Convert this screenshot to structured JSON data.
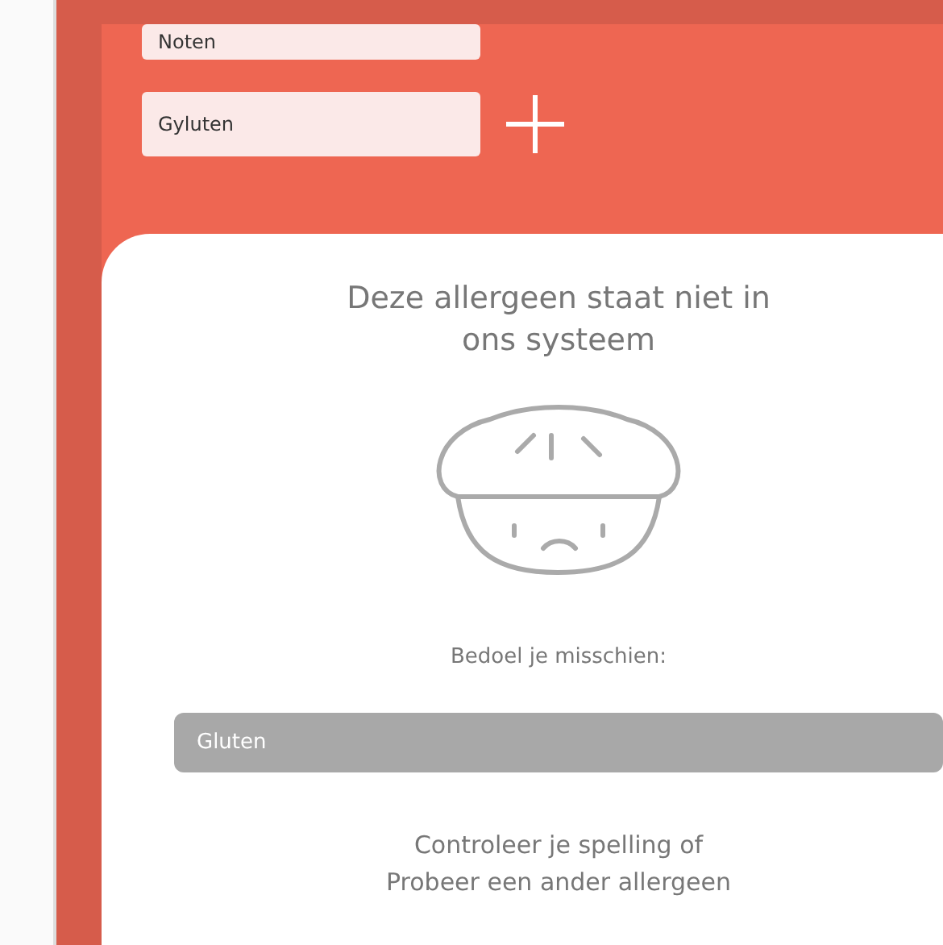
{
  "ingredients": [
    {
      "value": "Noten"
    },
    {
      "value": "Gyluten"
    }
  ],
  "result_card": {
    "title": "Deze allergeen staat niet in ons systeem",
    "suggestion_label": "Bedoel je misschien:",
    "suggestion": "Gluten",
    "hints": [
      "Controleer je spelling of",
      "Probeer een ander allergeen"
    ]
  }
}
